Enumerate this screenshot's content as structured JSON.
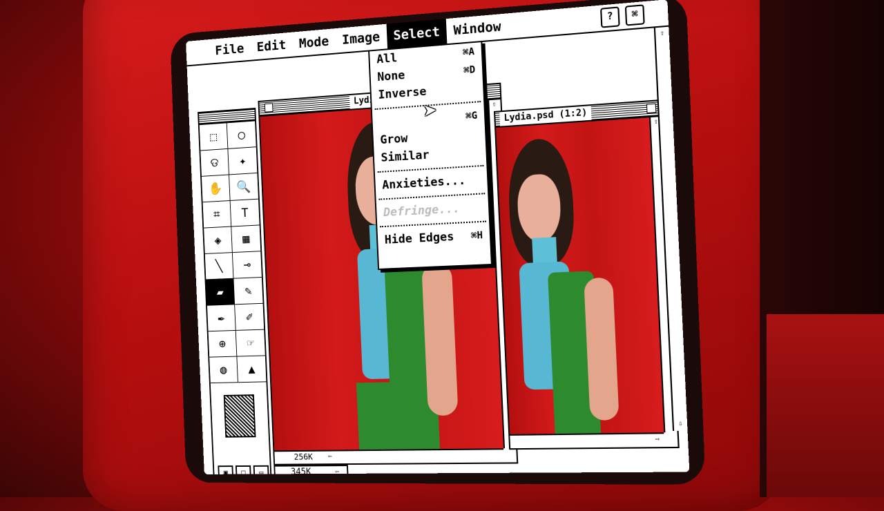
{
  "menubar": {
    "apple": "",
    "items": [
      "File",
      "Edit",
      "Mode",
      "Image",
      "Select",
      "Window"
    ],
    "active": "Select",
    "help_icon": "?"
  },
  "select_menu": {
    "items": [
      {
        "label": "All",
        "shortcut": "⌘A"
      },
      {
        "label": "None",
        "shortcut": "⌘D"
      },
      {
        "label": "Inverse",
        "shortcut": ""
      },
      {
        "label": "",
        "shortcut": "⌘G"
      },
      {
        "label": "Grow",
        "shortcut": ""
      },
      {
        "label": "Similar",
        "shortcut": ""
      },
      {
        "label": "Anxieties...",
        "shortcut": ""
      },
      {
        "label": "Defringe...",
        "shortcut": ""
      },
      {
        "label": "Hide Edges",
        "shortcut": "⌘H"
      }
    ]
  },
  "windows": {
    "back": {
      "title": "Lydia.psd",
      "mem_inner": "256K",
      "mem_outer": "345K"
    },
    "front": {
      "title": "Lydia.psd (1:2)"
    }
  },
  "toolbox": {
    "tools": [
      "rect-marquee-icon",
      "ellipse-marquee-icon",
      "lasso-icon",
      "magic-wand-icon",
      "hand-icon",
      "zoom-icon",
      "crop-icon",
      "type-icon",
      "paint-bucket-icon",
      "gradient-icon",
      "line-icon",
      "eyedropper-icon",
      "eraser-icon",
      "pencil-icon",
      "airbrush-icon",
      "brush-icon",
      "stamp-icon",
      "smudge-icon",
      "blur-icon",
      "sharpen-icon"
    ],
    "glyphs": [
      "⬚",
      "◯",
      "ଡ",
      "✦",
      "✋",
      "🔍",
      "⌗",
      "T",
      "◈",
      "▦",
      "╲",
      "⊸",
      "▰",
      "✎",
      "✒",
      "✐",
      "⊕",
      "☞",
      "◍",
      "▲"
    ]
  },
  "colors": {
    "accent_red": "#c41616",
    "shirt_blue": "#58b8d4",
    "dress_green": "#2e8a2e"
  }
}
